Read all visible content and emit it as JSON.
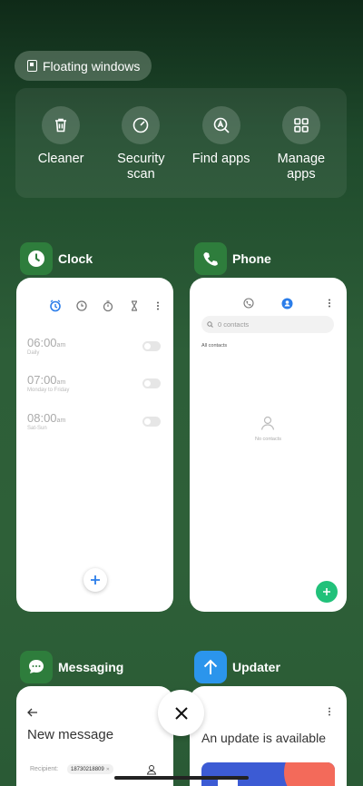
{
  "floating": {
    "label": "Floating windows"
  },
  "tools": [
    {
      "label": "Cleaner",
      "icon": "trash-icon"
    },
    {
      "label": "Security scan",
      "icon": "speed-icon"
    },
    {
      "label": "Find apps",
      "icon": "search-a-icon"
    },
    {
      "label": "Manage apps",
      "icon": "grid-icon"
    }
  ],
  "clock": {
    "title": "Clock",
    "alarms": [
      {
        "time": "06:00",
        "ampm": "am",
        "repeat": "Daily"
      },
      {
        "time": "07:00",
        "ampm": "am",
        "repeat": "Monday to Friday"
      },
      {
        "time": "08:00",
        "ampm": "am",
        "repeat": "Sat-Sun"
      }
    ]
  },
  "phone": {
    "title": "Phone",
    "search_placeholder": "0 contacts",
    "section": "All contacts",
    "empty": "No contacts"
  },
  "messaging": {
    "title": "Messaging",
    "heading": "New message",
    "recipient_label": "Recipient:",
    "recipient_value": "18730218809"
  },
  "updater": {
    "title": "Updater",
    "heading": "An update is available"
  },
  "colors": {
    "accent_blue": "#2b7de9",
    "accent_green": "#21c17a"
  }
}
